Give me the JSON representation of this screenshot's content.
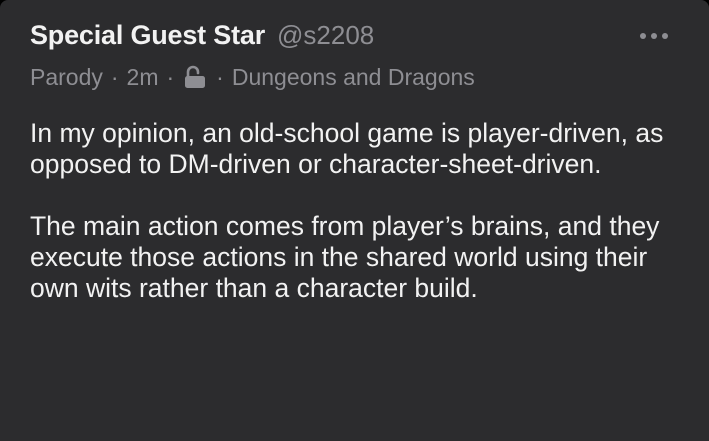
{
  "post": {
    "display_name": "Special Guest Star",
    "handle": "@s2208",
    "meta": {
      "label": "Parody",
      "separator": "·",
      "time": "2m",
      "lock_icon": "unlocked-padlock-icon",
      "community": "Dungeons and Dragons"
    },
    "more_icon": "more-horizontal-icon",
    "paragraphs": [
      "In my opinion, an old-school game is player-driven, as opposed to DM-driven or character-sheet-driven.",
      "The main action comes from player’s brains, and they execute those actions in the shared world using their own wits rather than a character build."
    ]
  },
  "colors": {
    "card_background": "#2c2c2e",
    "primary_text": "#f2f2f2",
    "secondary_text": "#8e8e93"
  }
}
